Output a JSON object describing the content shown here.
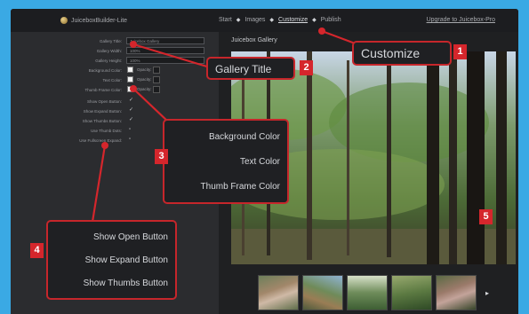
{
  "topbar": {
    "app_title": "JuiceboxBuilder-Lite",
    "steps": [
      "Start",
      "Images",
      "Customize",
      "Publish"
    ],
    "right_link": "Upgrade to Juicebox-Pro"
  },
  "settings": {
    "gallery_title_label": "Gallery Title:",
    "gallery_title_value": "Juicebox Gallery",
    "gallery_width_label": "Gallery Width:",
    "gallery_width_value": "100%",
    "gallery_height_label": "Gallery Height:",
    "gallery_height_value": "100%",
    "background_color_label": "Background Color:",
    "text_color_label": "Text Color:",
    "thumb_frame_color_label": "Thumb Frame Color:",
    "opacity_label": "Opacity:",
    "show_open_button_label": "Show Open Button:",
    "show_expand_button_label": "Show Expand Button:",
    "show_thumbs_button_label": "Show Thumbs Button:",
    "use_thumb_dots_label": "Use Thumb Dots:",
    "use_fullscreen_expand_label": "Use Fullscreen Expand:"
  },
  "gallery": {
    "title": "Juicebox Gallery"
  },
  "callouts": {
    "c1": "Customize",
    "c2": "Gallery Title",
    "c3": [
      "Background Color",
      "Text Color",
      "Thumb Frame Color"
    ],
    "c4": [
      "Show Open Button",
      "Show Expand Button",
      "Show Thumbs Button"
    ]
  },
  "badges": [
    "1",
    "2",
    "3",
    "4",
    "5"
  ],
  "colors": {
    "accent": "#d5262c",
    "page_bg": "#3aa9e4",
    "panel_bg": "#2b2c2f"
  }
}
